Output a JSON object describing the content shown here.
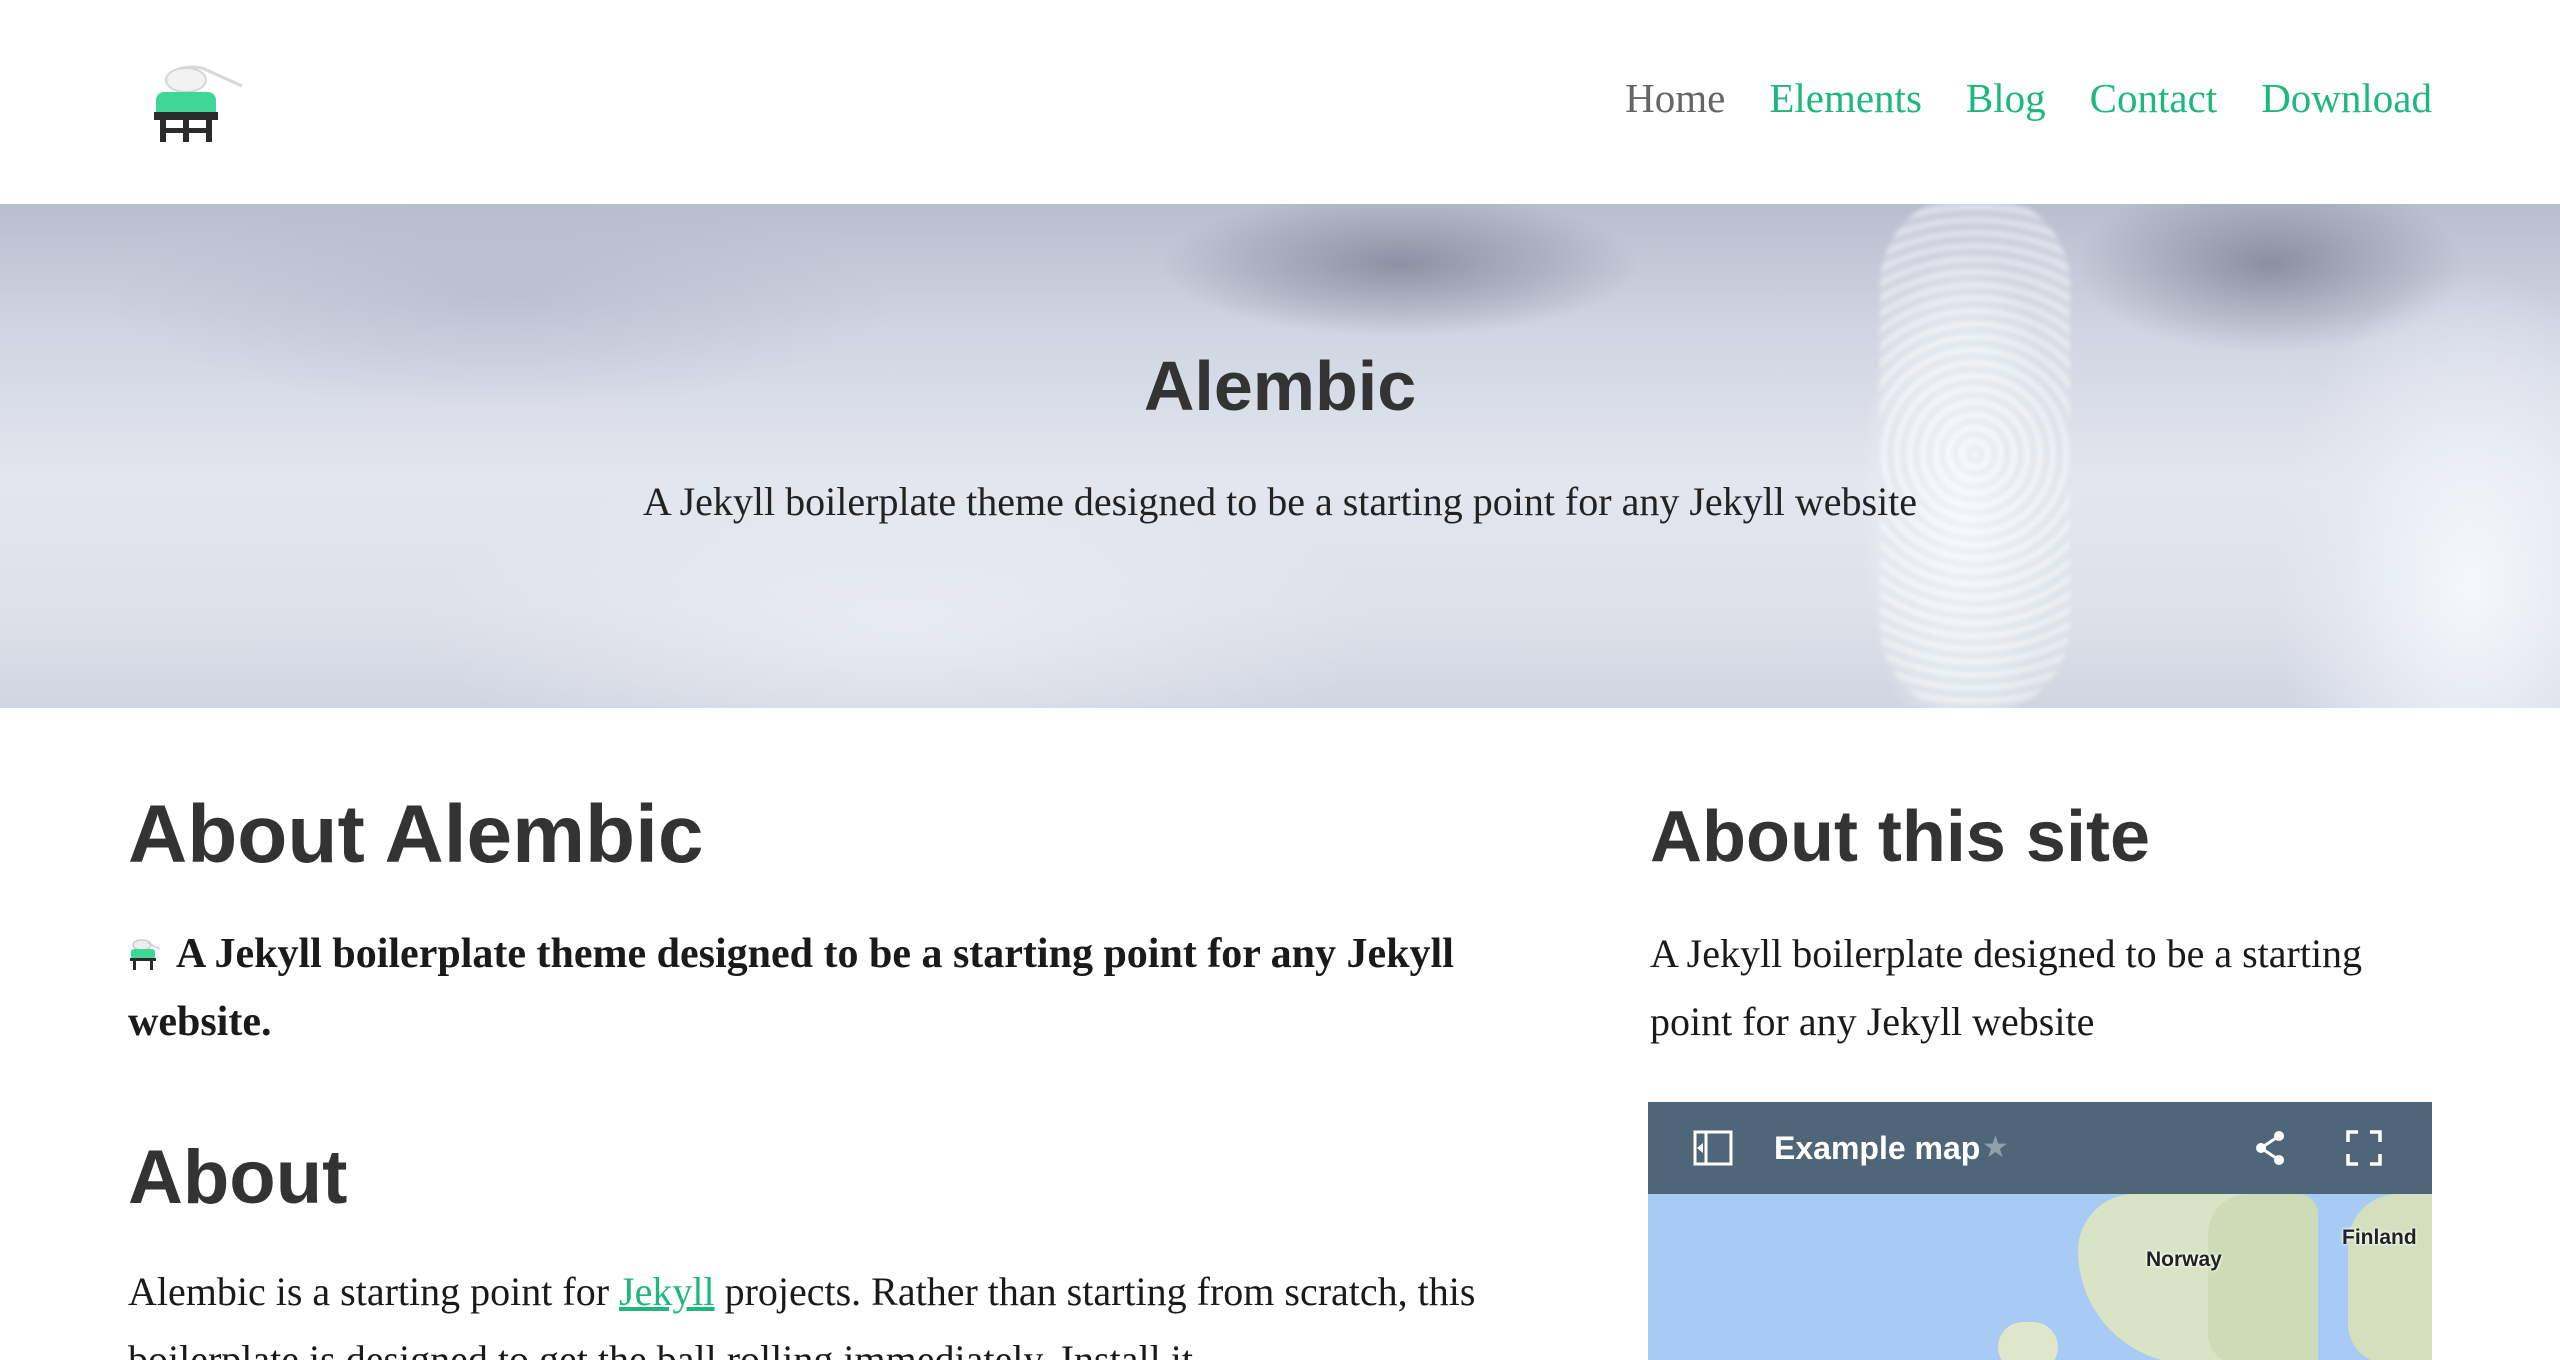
{
  "nav": {
    "items": [
      {
        "label": "Home",
        "active": true
      },
      {
        "label": "Elements"
      },
      {
        "label": "Blog"
      },
      {
        "label": "Contact"
      },
      {
        "label": "Download"
      }
    ]
  },
  "hero": {
    "title": "Alembic",
    "subtitle": "A Jekyll boilerplate theme designed to be a starting point for any Jekyll website"
  },
  "main": {
    "about_alembic_title": "About Alembic",
    "lead": "A Jekyll boilerplate theme designed to be a starting point for any Jekyll website.",
    "about_title": "About",
    "body_before_link": "Alembic is a starting point for ",
    "body_link": "Jekyll",
    "body_after_link": " projects. Rather than starting from scratch, this boilerplate is designed to get the ball rolling immediately. Install it"
  },
  "sidebar": {
    "title": "About this site",
    "text": "A Jekyll boilerplate designed to be a starting point for any Jekyll website",
    "map": {
      "title": "Example map",
      "star": "★",
      "labels": {
        "norway": "Norway",
        "finland": "Finland"
      }
    }
  },
  "colors": {
    "accent": "#1fb87c",
    "nav_active": "#666666",
    "map_bar": "#4f6678"
  },
  "icons": {
    "logo": "alembic-logo-icon",
    "sidebar_toggle": "sidebar-toggle-icon",
    "share": "share-icon",
    "fullscreen": "fullscreen-icon"
  }
}
